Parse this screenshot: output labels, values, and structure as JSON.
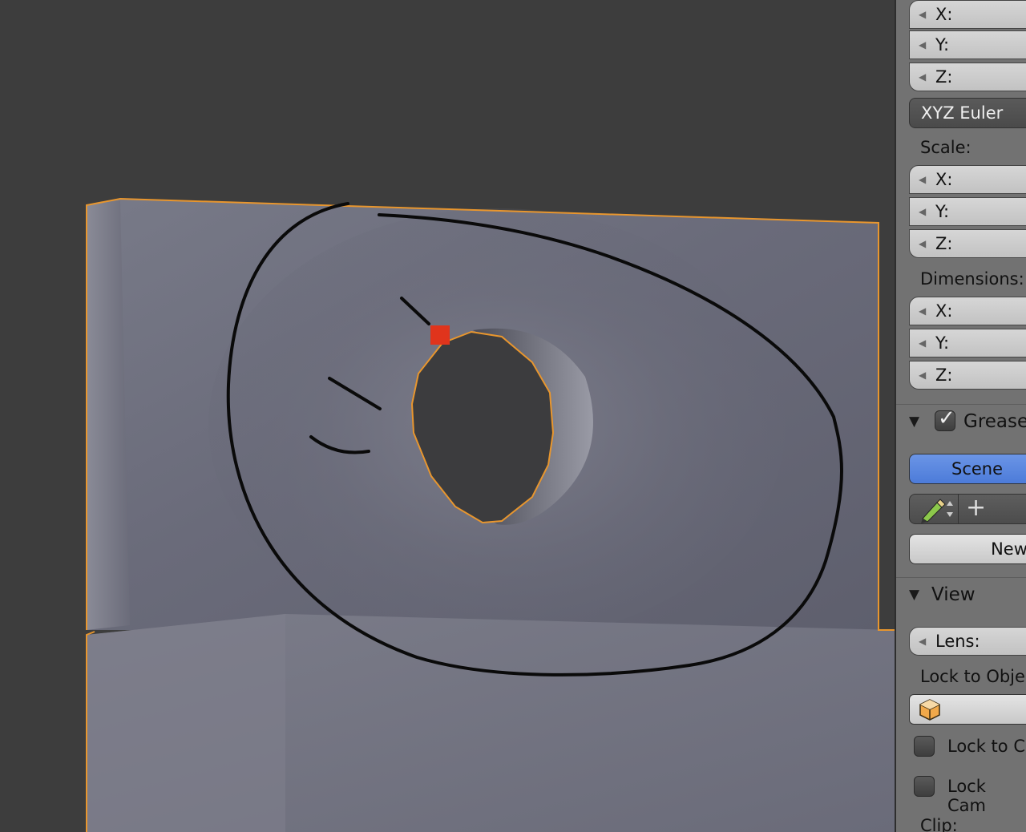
{
  "sidebar": {
    "rotation_fields": [
      {
        "axis": "X:"
      },
      {
        "axis": "Y:"
      },
      {
        "axis": "Z:"
      }
    ],
    "rotation_mode": "XYZ Euler",
    "scale_label": "Scale:",
    "scale_fields": [
      {
        "axis": "X:"
      },
      {
        "axis": "Y:"
      },
      {
        "axis": "Z:"
      }
    ],
    "dimensions_label": "Dimensions:",
    "dimensions_fields": [
      {
        "axis": "X:"
      },
      {
        "axis": "Y:"
      },
      {
        "axis": "Z:"
      }
    ],
    "grease_pencil": {
      "header": "Grease",
      "scene_button": "Scene",
      "new_button": "New",
      "add_icon": "plus-icon",
      "pencil_icon": "pencil-icon"
    },
    "view": {
      "header": "View",
      "lens_label": "Lens:",
      "lock_to_object_label": "Lock to Obje",
      "lock_to_cursor_label": "Lock to C",
      "lock_camera_label": "Lock Cam",
      "clip_label": "Clip:"
    }
  },
  "viewport": {
    "selection_color": "#e8962e",
    "vertex_color": "#e0341c",
    "mesh_color": "#6d6e7c",
    "background_color": "#3d3d3d"
  }
}
